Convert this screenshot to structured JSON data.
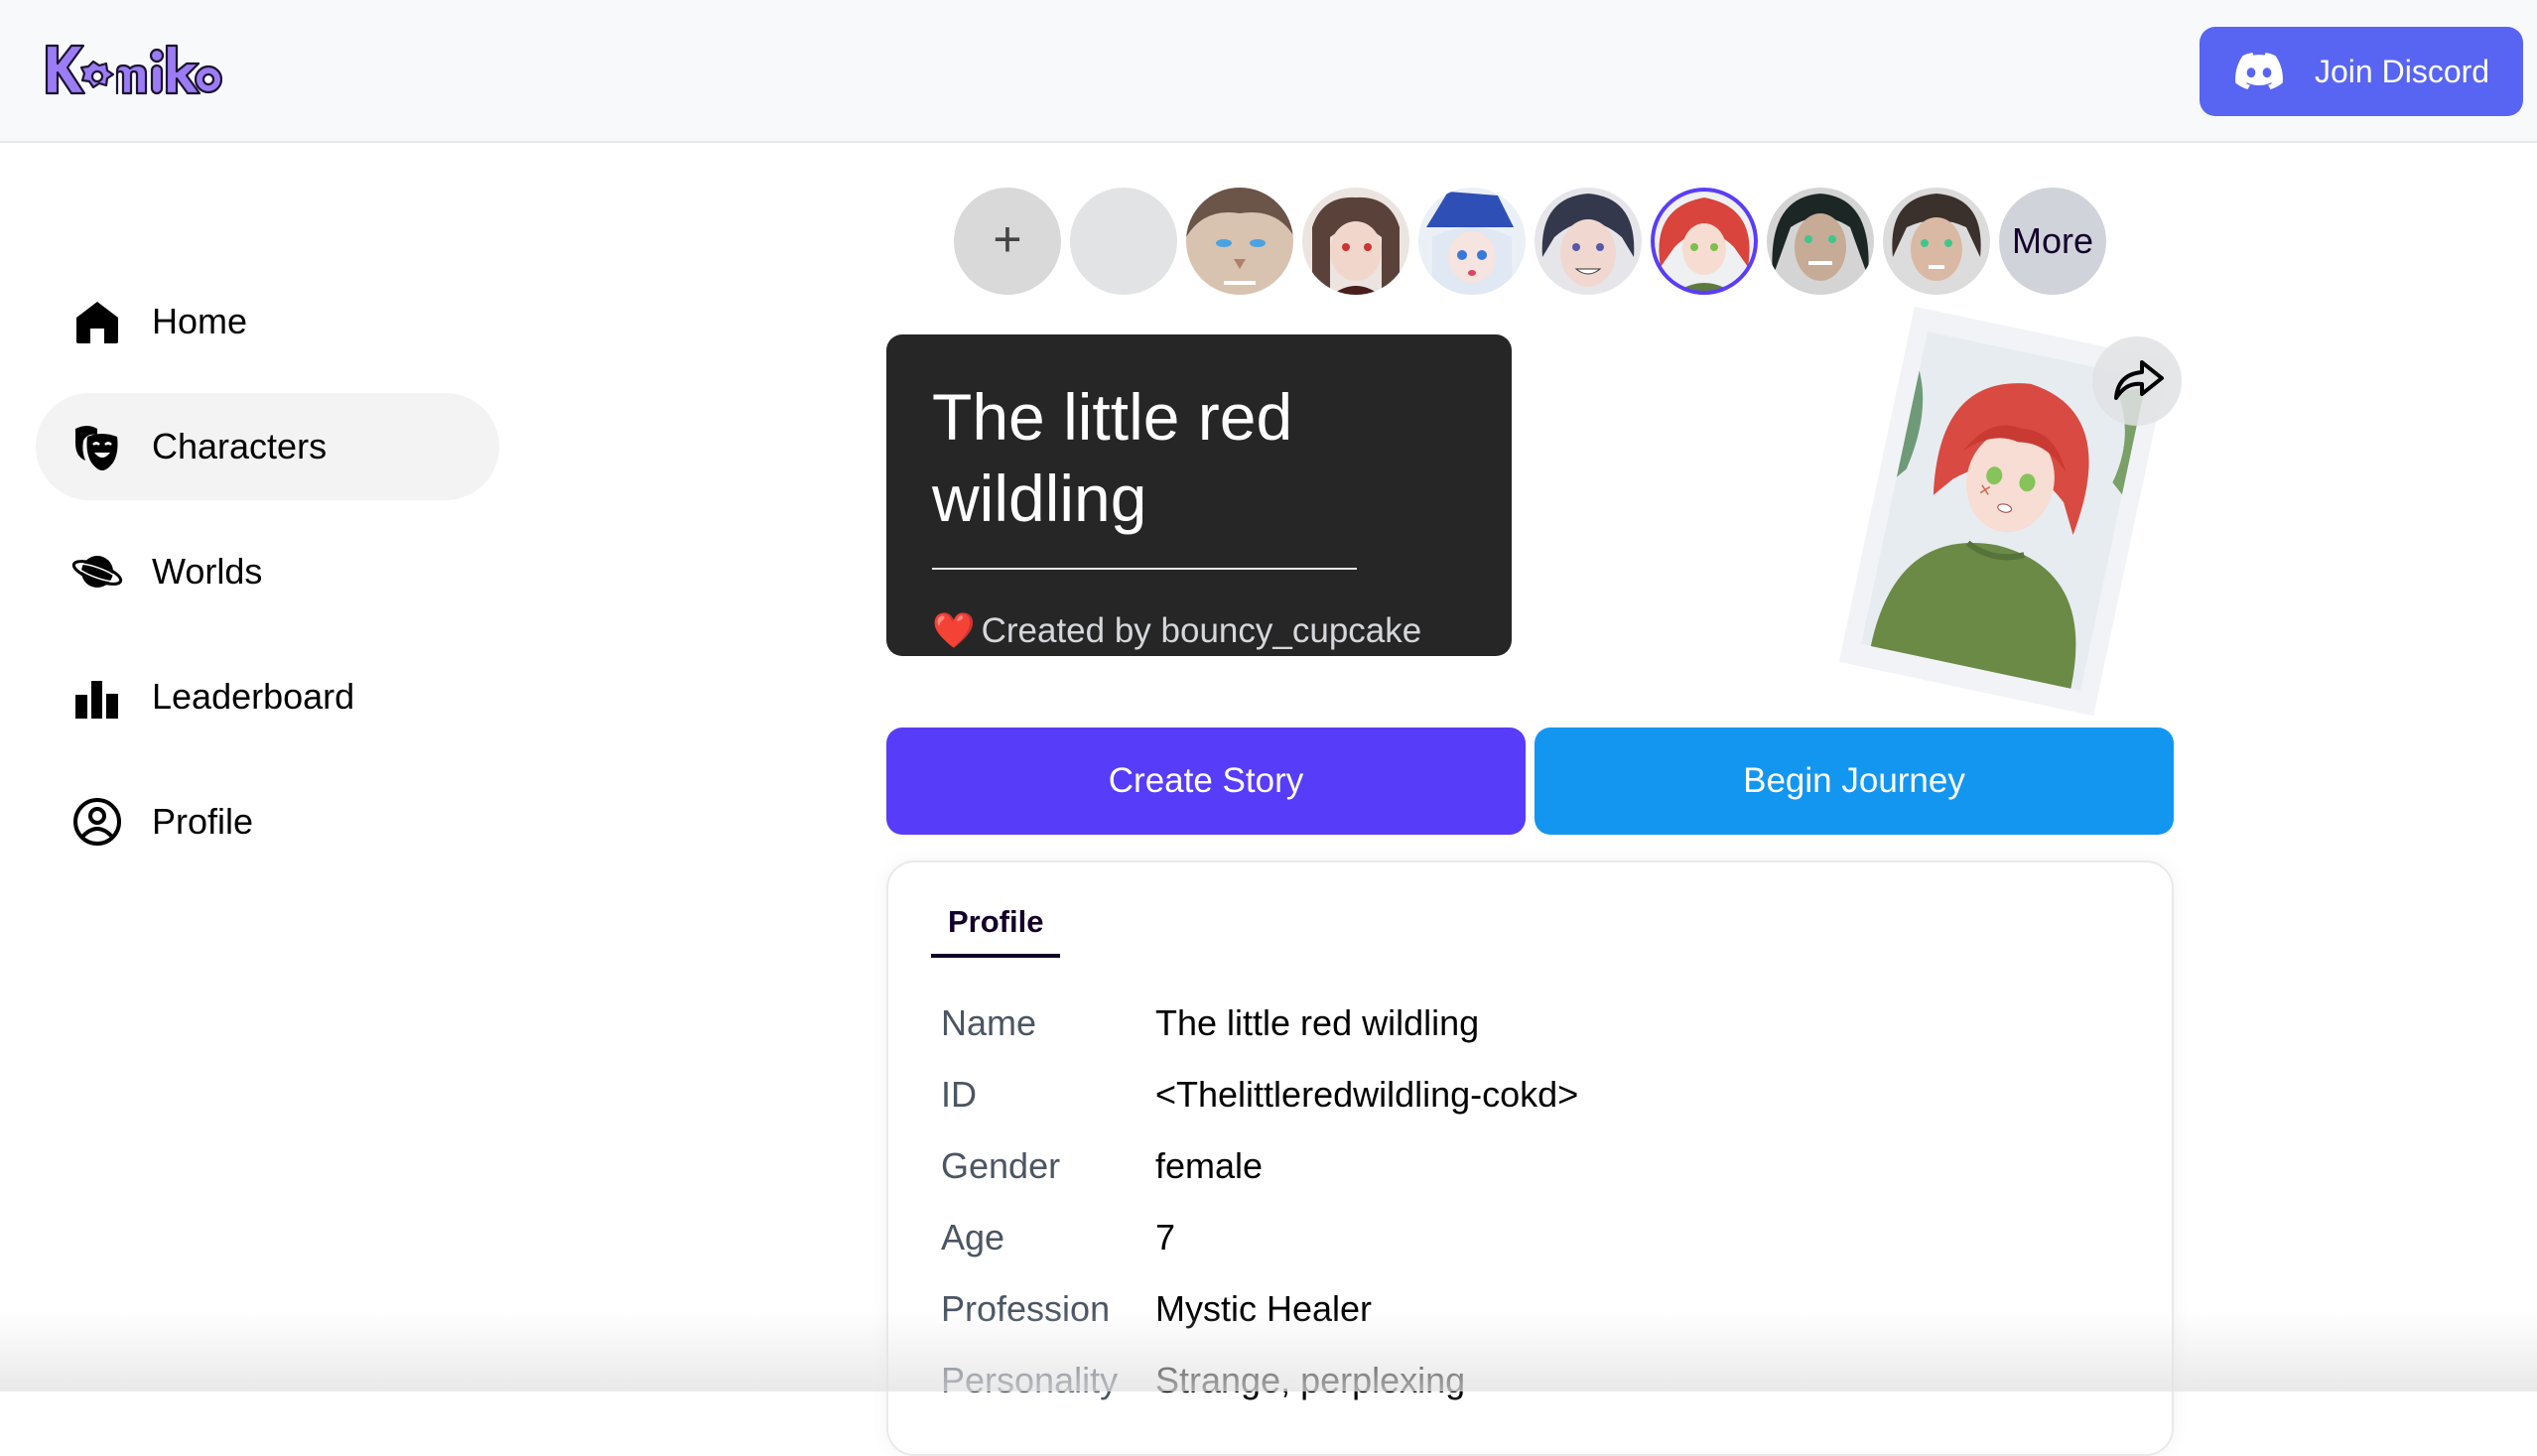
{
  "header": {
    "logo_text": "Komiko",
    "discord_button": {
      "label": "Join Discord",
      "icon": "discord-icon",
      "color": "#5865f2"
    }
  },
  "sidebar": {
    "items": [
      {
        "label": "Home",
        "icon": "home-icon",
        "active": false
      },
      {
        "label": "Characters",
        "icon": "theater-masks-icon",
        "active": true
      },
      {
        "label": "Worlds",
        "icon": "planet-icon",
        "active": false
      },
      {
        "label": "Leaderboard",
        "icon": "bar-chart-icon",
        "active": false
      },
      {
        "label": "Profile",
        "icon": "user-circle-icon",
        "active": false
      }
    ]
  },
  "avatar_strip": {
    "add_label": "+",
    "more_label": "More",
    "avatars": [
      {
        "kind": "add"
      },
      {
        "kind": "blank"
      },
      {
        "kind": "character",
        "description": "brown-haired man with blue eyes"
      },
      {
        "kind": "character",
        "description": "brown-haired girl with red eyes"
      },
      {
        "kind": "character",
        "description": "white-haired girl with blue hat"
      },
      {
        "kind": "character",
        "description": "dark-haired boy grinning"
      },
      {
        "kind": "character",
        "description": "red-haired girl with green eyes",
        "selected": true
      },
      {
        "kind": "character",
        "description": "dark-haired man with green eyes"
      },
      {
        "kind": "character",
        "description": "dark-haired man angry"
      },
      {
        "kind": "more"
      }
    ],
    "selected_color": "#5b3df5"
  },
  "character": {
    "title": "The little red wildling",
    "creator_prefix": "Created by",
    "creator": "bouncy_cupcake",
    "creator_line": "Created by bouncy_cupcake",
    "heart": "❤️",
    "share_icon": "share-arrow-icon"
  },
  "actions": {
    "create_story": {
      "label": "Create Story",
      "color": "#573cfa"
    },
    "begin_journey": {
      "label": "Begin Journey",
      "color": "#1396f0"
    }
  },
  "profile": {
    "tab_label": "Profile",
    "rows": [
      {
        "key": "Name",
        "value": "The little red wildling"
      },
      {
        "key": "ID",
        "value": "<Thelittleredwildling-cokd>"
      },
      {
        "key": "Gender",
        "value": "female"
      },
      {
        "key": "Age",
        "value": "7"
      },
      {
        "key": "Profession",
        "value": "Mystic Healer"
      },
      {
        "key": "Personality",
        "value": "Strange, perplexing"
      }
    ]
  }
}
